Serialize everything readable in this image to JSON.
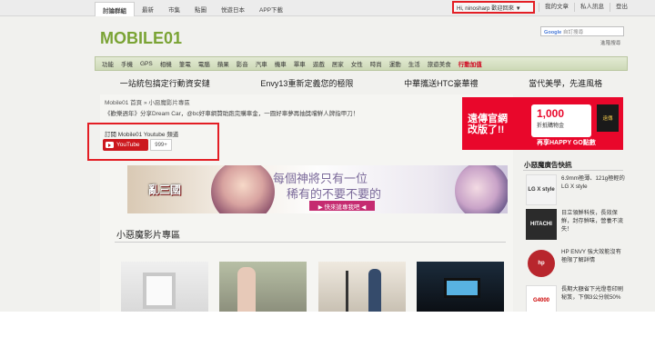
{
  "topbar": {
    "tabs": [
      "討論群組",
      "最新",
      "市集",
      "點圖",
      "悦遊日本",
      "APP下載"
    ],
    "user_menu": "Hi, ninosharp 歡迎回來 ▼",
    "right_links": [
      "我的文章",
      "私人訊息",
      "登出"
    ]
  },
  "header": {
    "logo_text": "MOBILE01",
    "search_placeholder": "自訂搜尋",
    "advanced_search": "進階搜尋"
  },
  "nav": {
    "items": [
      "功能",
      "手機",
      "GPS",
      "相機",
      "筆電",
      "電腦",
      "蘋果",
      "影音",
      "汽車",
      "機車",
      "單車",
      "遊戲",
      "居家",
      "女性",
      "時尚",
      "運動",
      "生活",
      "旅遊美食",
      "行動加值"
    ]
  },
  "promos": [
    "一站統包搞定行動資安鏈",
    "Envy13重新定義您的極限",
    "中華攜送HTC豪華禮",
    "當代美學，先進風格"
  ],
  "content": {
    "breadcrumb": "Mobile01 首頁 » 小惡魔影片專區",
    "description": "《歡樂週年》分享Dream Car，@bc好車網贊助跑完購車金，一圓好車夢再抽獎嚐鮮人牌指甲刀！",
    "subscribe_title": "訂閱 Mobile01 Youtube 頻道",
    "youtube_label": "YouTube",
    "subscriber_count": "999+",
    "section_title": "小惡魔影片專區"
  },
  "game_ad": {
    "logo": "亂三國",
    "line1": "每個神將只有一位",
    "line2": "稀有的不要不要的",
    "cta": "▶ 快來搶專我吧 ◀"
  },
  "right_ad": {
    "left_text_1": "遠傳官網",
    "left_text_2": "改版了!!",
    "amount": "1,000",
    "amount_sub": "折抵購物金",
    "happy_go": "再享HAPPY GO點數",
    "tag": "遠傳"
  },
  "sidebar": {
    "title": "小惡魔廣告快訊",
    "items": [
      {
        "thumb": "LG X style",
        "text": "6.9mm極薄、121g極輕的 LG X style"
      },
      {
        "thumb": "HITACHI",
        "text": "日立領鮮科技，長效保鮮，封存鮮味，營養不流失！"
      },
      {
        "thumb": "hp",
        "text": "HP ENVY 強大效能沒有極限了解詳情"
      },
      {
        "thumb": "G4000",
        "text": "長期大額省下光燈卷印刷秘笈，下個3公分就50%"
      }
    ]
  }
}
